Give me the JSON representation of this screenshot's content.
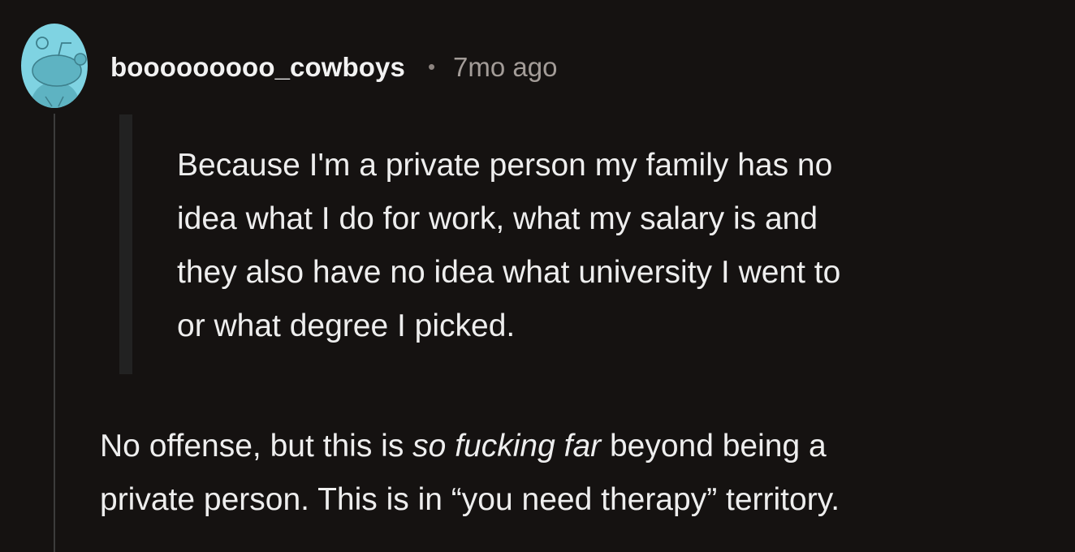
{
  "comment": {
    "username": "booooooooo_cowboys",
    "separator": "•",
    "timestamp": "7mo ago",
    "avatar_icon": "snoo-avatar-icon",
    "quote": {
      "lines": [
        "Because I'm a private person my family has no",
        "idea what I do for work, what my salary is and",
        "they also have no idea what university I went to",
        "or what degree I picked."
      ]
    },
    "reply": {
      "line1_before": "No offense, but this is ",
      "line1_italic": "so fucking far",
      "line1_after": " beyond being a",
      "line2": "private person. This is in “you need therapy” territory."
    },
    "colors": {
      "background": "#151211",
      "avatar_bg": "#7fd3e2",
      "text": "#eeeeee",
      "muted": "#a39c98"
    }
  }
}
